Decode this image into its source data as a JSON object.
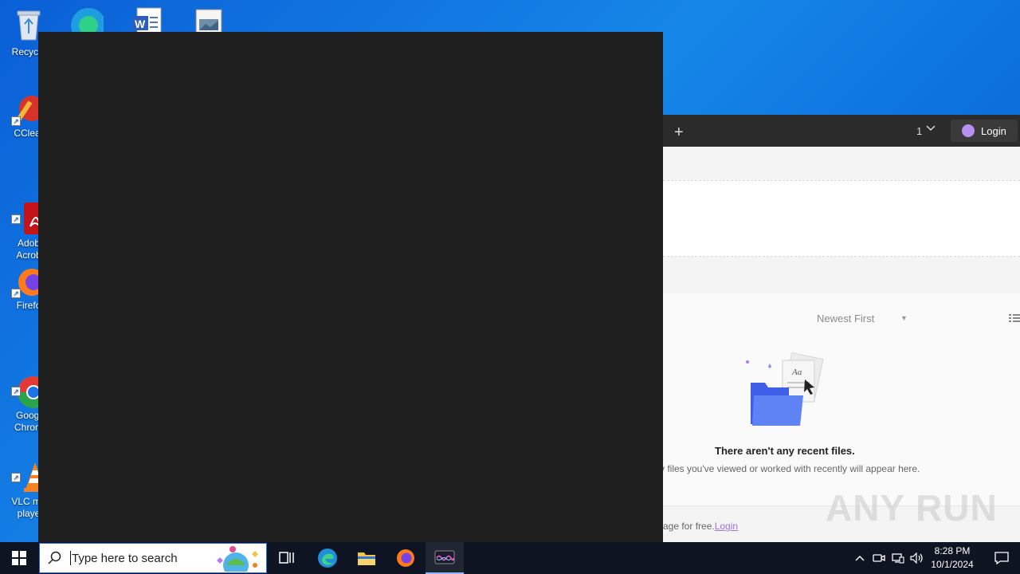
{
  "desktop": {
    "icons": [
      {
        "label": "Recycle",
        "name": "recycle-bin"
      },
      {
        "label": "CClear",
        "name": "ccleaner"
      },
      {
        "label": "Adob\nAcrob",
        "name": "adobe-acrobat"
      },
      {
        "label": "Firefo",
        "name": "firefox"
      },
      {
        "label": "Googl\nChrom",
        "name": "google-chrome"
      },
      {
        "label": "VLC me\nplaye",
        "name": "vlc-media-player"
      }
    ]
  },
  "app": {
    "tab_count": "1",
    "login_label": "Login",
    "sort_label": "Newest First",
    "empty_title": "There aren't any recent files.",
    "empty_subtitle": "y files you've viewed or worked with recently will appear here.",
    "footer_text": "rage for free.",
    "footer_link": "Login",
    "watermark": "ANY RUN"
  },
  "taskbar": {
    "search_placeholder": "Type here to search",
    "time": "8:28 PM",
    "date": "10/1/2024"
  },
  "colors": {
    "desktop_blue": "#1686e8",
    "dark_window": "#1f1f1f",
    "taskbar": "#0f1422",
    "accent_purple": "#a36ee0"
  }
}
